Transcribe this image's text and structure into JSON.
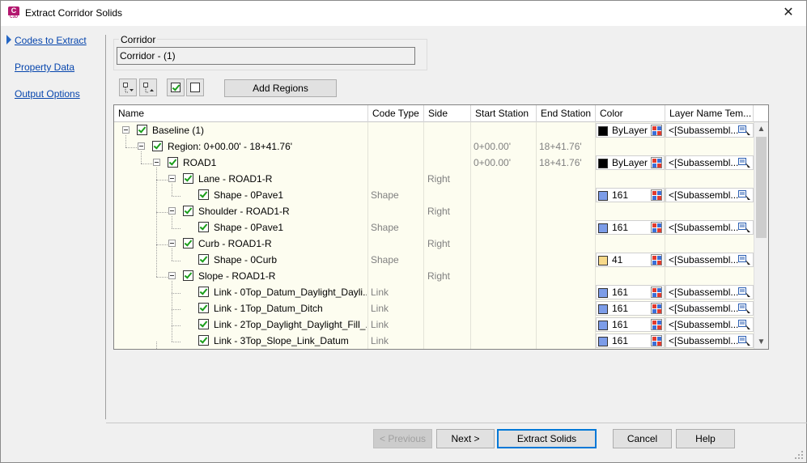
{
  "window": {
    "title": "Extract Corridor Solids",
    "app_icon": "C",
    "app_icon_sub": "C3D"
  },
  "nav": {
    "items": [
      {
        "label": "Codes to Extract",
        "active": true
      },
      {
        "label": "Property Data",
        "active": false
      },
      {
        "label": "Output Options",
        "active": false
      }
    ]
  },
  "corridor": {
    "group_label": "Corridor",
    "value": "Corridor - (1)"
  },
  "toolbar": {
    "add_regions_label": "Add Regions"
  },
  "grid": {
    "columns": [
      "Name",
      "Code Type",
      "Side",
      "Start Station",
      "End Station",
      "Color",
      "Layer Name Tem..."
    ],
    "rows": [
      {
        "name": "Baseline (1)",
        "code_type": "",
        "side": "",
        "start": "",
        "end": "",
        "color": "ByLayer",
        "swatch": "#000000",
        "layer": "<[Subassembl..."
      },
      {
        "name": "Region: 0+00.00' - 18+41.76'",
        "code_type": "",
        "side": "",
        "start": "0+00.00'",
        "end": "18+41.76'",
        "color": "",
        "swatch": "",
        "layer": ""
      },
      {
        "name": "ROAD1",
        "code_type": "",
        "side": "",
        "start": "0+00.00'",
        "end": "18+41.76'",
        "color": "ByLayer",
        "swatch": "#000000",
        "layer": "<[Subassembl..."
      },
      {
        "name": "Lane - ROAD1-R",
        "code_type": "",
        "side": "Right",
        "start": "",
        "end": "",
        "color": "",
        "swatch": "",
        "layer": ""
      },
      {
        "name": "Shape - 0Pave1",
        "code_type": "Shape",
        "side": "",
        "start": "",
        "end": "",
        "color": "161",
        "swatch": "#7c9ce8",
        "layer": "<[Subassembl..."
      },
      {
        "name": "Shoulder - ROAD1-R",
        "code_type": "",
        "side": "Right",
        "start": "",
        "end": "",
        "color": "",
        "swatch": "",
        "layer": ""
      },
      {
        "name": "Shape - 0Pave1",
        "code_type": "Shape",
        "side": "",
        "start": "",
        "end": "",
        "color": "161",
        "swatch": "#7c9ce8",
        "layer": "<[Subassembl..."
      },
      {
        "name": "Curb - ROAD1-R",
        "code_type": "",
        "side": "Right",
        "start": "",
        "end": "",
        "color": "",
        "swatch": "",
        "layer": ""
      },
      {
        "name": "Shape - 0Curb",
        "code_type": "Shape",
        "side": "",
        "start": "",
        "end": "",
        "color": "41",
        "swatch": "#f7d98a",
        "layer": "<[Subassembl..."
      },
      {
        "name": "Slope - ROAD1-R",
        "code_type": "",
        "side": "Right",
        "start": "",
        "end": "",
        "color": "",
        "swatch": "",
        "layer": ""
      },
      {
        "name": "Link - 0Top_Datum_Daylight_Dayli...",
        "code_type": "Link",
        "side": "",
        "start": "",
        "end": "",
        "color": "161",
        "swatch": "#7c9ce8",
        "layer": "<[Subassembl..."
      },
      {
        "name": "Link - 1Top_Datum_Ditch",
        "code_type": "Link",
        "side": "",
        "start": "",
        "end": "",
        "color": "161",
        "swatch": "#7c9ce8",
        "layer": "<[Subassembl..."
      },
      {
        "name": "Link - 2Top_Daylight_Daylight_Fill_...",
        "code_type": "Link",
        "side": "",
        "start": "",
        "end": "",
        "color": "161",
        "swatch": "#7c9ce8",
        "layer": "<[Subassembl..."
      },
      {
        "name": "Link - 3Top_Slope_Link_Datum",
        "code_type": "Link",
        "side": "",
        "start": "",
        "end": "",
        "color": "161",
        "swatch": "#7c9ce8",
        "layer": "<[Subassembl..."
      }
    ]
  },
  "buttons": {
    "previous": "< Previous",
    "next": "Next >",
    "extract": "Extract Solids",
    "cancel": "Cancel",
    "help": "Help"
  }
}
